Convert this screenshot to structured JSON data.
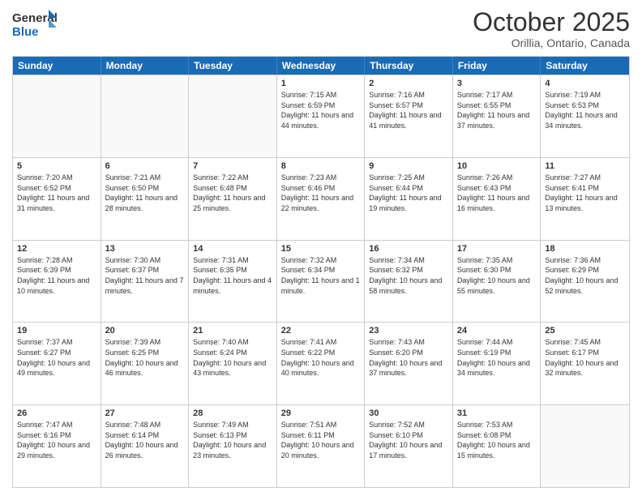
{
  "header": {
    "logo": {
      "line1": "General",
      "line2": "Blue"
    },
    "title": "October 2025",
    "location": "Orillia, Ontario, Canada"
  },
  "weekdays": [
    "Sunday",
    "Monday",
    "Tuesday",
    "Wednesday",
    "Thursday",
    "Friday",
    "Saturday"
  ],
  "rows": [
    [
      {
        "day": "",
        "empty": true
      },
      {
        "day": "",
        "empty": true
      },
      {
        "day": "",
        "empty": true
      },
      {
        "day": "1",
        "sunrise": "7:15 AM",
        "sunset": "6:59 PM",
        "daylight": "11 hours and 44 minutes."
      },
      {
        "day": "2",
        "sunrise": "7:16 AM",
        "sunset": "6:57 PM",
        "daylight": "11 hours and 41 minutes."
      },
      {
        "day": "3",
        "sunrise": "7:17 AM",
        "sunset": "6:55 PM",
        "daylight": "11 hours and 37 minutes."
      },
      {
        "day": "4",
        "sunrise": "7:19 AM",
        "sunset": "6:53 PM",
        "daylight": "11 hours and 34 minutes."
      }
    ],
    [
      {
        "day": "5",
        "sunrise": "7:20 AM",
        "sunset": "6:52 PM",
        "daylight": "11 hours and 31 minutes."
      },
      {
        "day": "6",
        "sunrise": "7:21 AM",
        "sunset": "6:50 PM",
        "daylight": "11 hours and 28 minutes."
      },
      {
        "day": "7",
        "sunrise": "7:22 AM",
        "sunset": "6:48 PM",
        "daylight": "11 hours and 25 minutes."
      },
      {
        "day": "8",
        "sunrise": "7:23 AM",
        "sunset": "6:46 PM",
        "daylight": "11 hours and 22 minutes."
      },
      {
        "day": "9",
        "sunrise": "7:25 AM",
        "sunset": "6:44 PM",
        "daylight": "11 hours and 19 minutes."
      },
      {
        "day": "10",
        "sunrise": "7:26 AM",
        "sunset": "6:43 PM",
        "daylight": "11 hours and 16 minutes."
      },
      {
        "day": "11",
        "sunrise": "7:27 AM",
        "sunset": "6:41 PM",
        "daylight": "11 hours and 13 minutes."
      }
    ],
    [
      {
        "day": "12",
        "sunrise": "7:28 AM",
        "sunset": "6:39 PM",
        "daylight": "11 hours and 10 minutes."
      },
      {
        "day": "13",
        "sunrise": "7:30 AM",
        "sunset": "6:37 PM",
        "daylight": "11 hours and 7 minutes."
      },
      {
        "day": "14",
        "sunrise": "7:31 AM",
        "sunset": "6:35 PM",
        "daylight": "11 hours and 4 minutes."
      },
      {
        "day": "15",
        "sunrise": "7:32 AM",
        "sunset": "6:34 PM",
        "daylight": "11 hours and 1 minute."
      },
      {
        "day": "16",
        "sunrise": "7:34 AM",
        "sunset": "6:32 PM",
        "daylight": "10 hours and 58 minutes."
      },
      {
        "day": "17",
        "sunrise": "7:35 AM",
        "sunset": "6:30 PM",
        "daylight": "10 hours and 55 minutes."
      },
      {
        "day": "18",
        "sunrise": "7:36 AM",
        "sunset": "6:29 PM",
        "daylight": "10 hours and 52 minutes."
      }
    ],
    [
      {
        "day": "19",
        "sunrise": "7:37 AM",
        "sunset": "6:27 PM",
        "daylight": "10 hours and 49 minutes."
      },
      {
        "day": "20",
        "sunrise": "7:39 AM",
        "sunset": "6:25 PM",
        "daylight": "10 hours and 46 minutes."
      },
      {
        "day": "21",
        "sunrise": "7:40 AM",
        "sunset": "6:24 PM",
        "daylight": "10 hours and 43 minutes."
      },
      {
        "day": "22",
        "sunrise": "7:41 AM",
        "sunset": "6:22 PM",
        "daylight": "10 hours and 40 minutes."
      },
      {
        "day": "23",
        "sunrise": "7:43 AM",
        "sunset": "6:20 PM",
        "daylight": "10 hours and 37 minutes."
      },
      {
        "day": "24",
        "sunrise": "7:44 AM",
        "sunset": "6:19 PM",
        "daylight": "10 hours and 34 minutes."
      },
      {
        "day": "25",
        "sunrise": "7:45 AM",
        "sunset": "6:17 PM",
        "daylight": "10 hours and 32 minutes."
      }
    ],
    [
      {
        "day": "26",
        "sunrise": "7:47 AM",
        "sunset": "6:16 PM",
        "daylight": "10 hours and 29 minutes."
      },
      {
        "day": "27",
        "sunrise": "7:48 AM",
        "sunset": "6:14 PM",
        "daylight": "10 hours and 26 minutes."
      },
      {
        "day": "28",
        "sunrise": "7:49 AM",
        "sunset": "6:13 PM",
        "daylight": "10 hours and 23 minutes."
      },
      {
        "day": "29",
        "sunrise": "7:51 AM",
        "sunset": "6:11 PM",
        "daylight": "10 hours and 20 minutes."
      },
      {
        "day": "30",
        "sunrise": "7:52 AM",
        "sunset": "6:10 PM",
        "daylight": "10 hours and 17 minutes."
      },
      {
        "day": "31",
        "sunrise": "7:53 AM",
        "sunset": "6:08 PM",
        "daylight": "10 hours and 15 minutes."
      },
      {
        "day": "",
        "empty": true
      }
    ]
  ]
}
